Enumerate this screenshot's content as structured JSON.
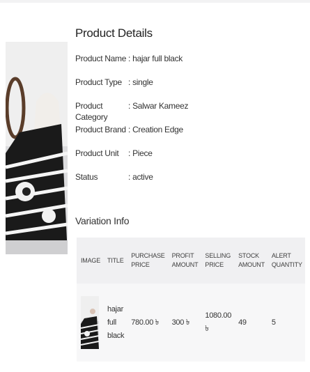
{
  "details": {
    "title": "Product Details",
    "rows": [
      {
        "label": "Product Name",
        "value": ": hajar full black"
      },
      {
        "label": "Product Type",
        "value": ": single"
      },
      {
        "label": "Product Category",
        "value": ": Salwar Kameez"
      },
      {
        "label": "Product Brand",
        "value": ": Creation Edge"
      },
      {
        "label": "Product Unit",
        "value": ": Piece"
      },
      {
        "label": "Status",
        "value": ": active"
      }
    ]
  },
  "variation": {
    "title": "Variation Info",
    "headers": {
      "image": "IMAGE",
      "title": "TITLE",
      "purchase_price": "PURCHASE PRICE",
      "profit_amount": "PROFIT AMOUNT",
      "selling_price": "SELLING PRICE",
      "stock_amount": "STOCK AMOUNT",
      "alert_quantity": "ALERT QUANTITY"
    },
    "rows": [
      {
        "title": "hajar full black",
        "purchase_price": "780.00 ৳",
        "profit_amount": "300 ৳",
        "selling_price": "1080.00 ৳",
        "stock_amount": "49",
        "alert_quantity": "5"
      }
    ]
  }
}
